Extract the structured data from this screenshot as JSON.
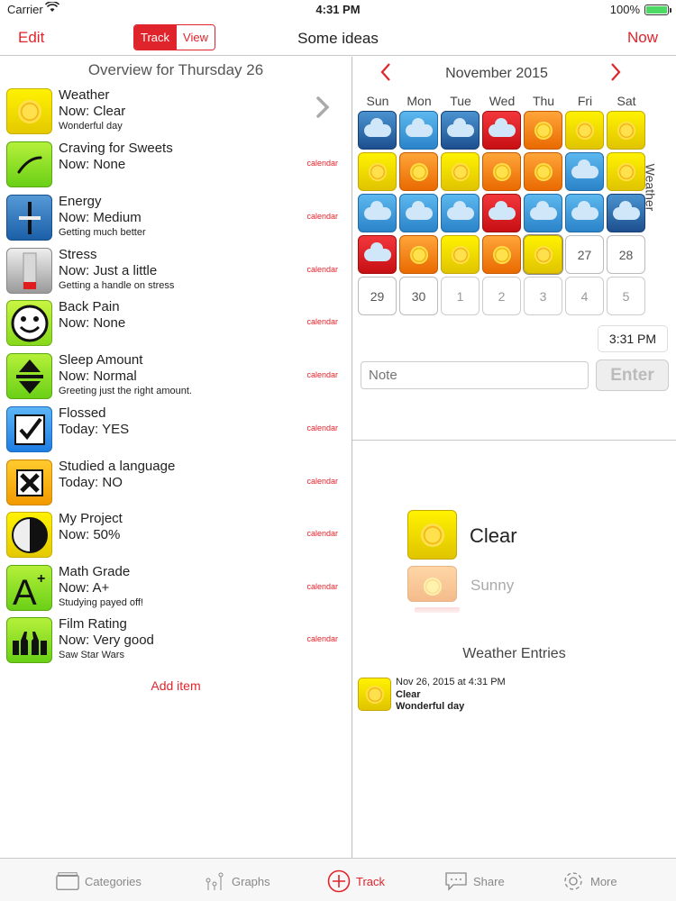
{
  "status_bar": {
    "carrier": "Carrier",
    "time": "4:31 PM",
    "battery": "100%"
  },
  "nav": {
    "edit": "Edit",
    "title": "Some ideas",
    "now": "Now",
    "segments": [
      "Track",
      "View"
    ],
    "active_segment": "Track"
  },
  "overview": {
    "title": "Overview for Thursday 26"
  },
  "items": [
    {
      "name": "Weather",
      "now": "Now: Clear",
      "note": "Wonderful day",
      "link": "",
      "icon": "sun-icon"
    },
    {
      "name": "Craving for Sweets",
      "now": "Now: None",
      "note": "",
      "link": "calendar",
      "icon": "curve-icon"
    },
    {
      "name": "Energy",
      "now": "Now: Medium",
      "note": "Getting much better",
      "link": "calendar",
      "icon": "slider-icon"
    },
    {
      "name": "Stress",
      "now": "Now: Just a little",
      "note": "Getting a handle on stress",
      "link": "calendar",
      "icon": "battery-level-icon"
    },
    {
      "name": "Back Pain",
      "now": "Now: None",
      "note": "",
      "link": "calendar",
      "icon": "smiley-icon"
    },
    {
      "name": "Sleep Amount",
      "now": "Now: Normal",
      "note": "Greeting just the right amount.",
      "link": "calendar",
      "icon": "up-down-arrows-icon"
    },
    {
      "name": "Flossed",
      "now": "Today: YES",
      "note": "",
      "link": "calendar",
      "icon": "checkmark-icon"
    },
    {
      "name": "Studied a language",
      "now": "Today: NO",
      "note": "",
      "link": "calendar",
      "icon": "x-mark-icon"
    },
    {
      "name": "My Project",
      "now": "Now: 50%",
      "note": "",
      "link": "calendar",
      "icon": "half-circle-icon"
    },
    {
      "name": "Math Grade",
      "now": "Now: A+",
      "note": "Studying payed off!",
      "link": "calendar",
      "icon": "grade-a-plus-icon"
    },
    {
      "name": "Film Rating",
      "now": "Now: Very good",
      "note": "Saw Star Wars",
      "link": "calendar",
      "icon": "thumbs-up-icon"
    }
  ],
  "add_item": "Add item",
  "calendar": {
    "month": "November 2015",
    "weekdays": [
      "Sun",
      "Mon",
      "Tue",
      "Wed",
      "Thu",
      "Fri",
      "Sat"
    ],
    "side_label": "Weather",
    "weeks": [
      [
        "storm",
        "cloud",
        "storm",
        "red",
        "sunny",
        "sun",
        "sun"
      ],
      [
        "sun",
        "sunny",
        "sun",
        "sunny",
        "sunny",
        "cloud",
        "sun"
      ],
      [
        "cloud",
        "cloud",
        "cloud",
        "red",
        "cloud",
        "cloud",
        "storm"
      ],
      [
        "red",
        "sunny",
        "sun",
        "sunny",
        "sun",
        "27",
        "28"
      ],
      [
        "29",
        "30",
        "1",
        "2",
        "3",
        "4",
        "5"
      ]
    ],
    "selected_day": "26"
  },
  "entry_form": {
    "time": "3:31 PM",
    "note_placeholder": "Note",
    "enter": "Enter"
  },
  "picker": {
    "selected": "Clear",
    "next": "Sunny"
  },
  "entries": {
    "title": "Weather Entries",
    "list": [
      {
        "date": "Nov 26, 2015 at 4:31 PM",
        "value": "Clear",
        "note": "Wonderful day"
      }
    ]
  },
  "tabs": [
    {
      "label": "Categories",
      "icon": "folder-icon"
    },
    {
      "label": "Graphs",
      "icon": "graph-icon"
    },
    {
      "label": "Track",
      "icon": "plus-circle-icon"
    },
    {
      "label": "Share",
      "icon": "share-icon"
    },
    {
      "label": "More",
      "icon": "gear-icon"
    }
  ],
  "colors": {
    "accent": "#e0242b"
  }
}
